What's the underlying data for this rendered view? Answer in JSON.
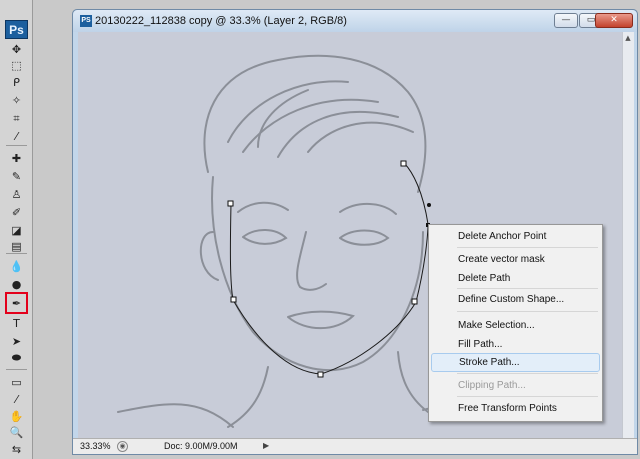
{
  "app": {
    "logo": "Ps"
  },
  "tools": [
    {
      "icon": "move-tool-icon",
      "glyph": "✥"
    },
    {
      "icon": "marquee-tool-icon",
      "glyph": "⬚"
    },
    {
      "icon": "lasso-tool-icon",
      "glyph": "ᑭ"
    },
    {
      "icon": "magic-wand-icon",
      "glyph": "✧"
    },
    {
      "icon": "crop-tool-icon",
      "glyph": "⌗"
    },
    {
      "icon": "eyedropper-tool-icon",
      "glyph": "⁄"
    },
    {
      "icon": "healing-brush-icon",
      "glyph": "✚"
    },
    {
      "icon": "brush-tool-icon",
      "glyph": "✎"
    },
    {
      "icon": "clone-stamp-icon",
      "glyph": "♙"
    },
    {
      "icon": "history-brush-icon",
      "glyph": "✐"
    },
    {
      "icon": "eraser-tool-icon",
      "glyph": "◪"
    },
    {
      "icon": "gradient-tool-icon",
      "glyph": "▤"
    },
    {
      "icon": "blur-tool-icon",
      "glyph": "💧"
    },
    {
      "icon": "dodge-tool-icon",
      "glyph": "●"
    },
    {
      "icon": "pen-tool-icon",
      "glyph": "✒"
    },
    {
      "icon": "type-tool-icon",
      "glyph": "T"
    },
    {
      "icon": "path-selection-icon",
      "glyph": "➤"
    },
    {
      "icon": "shape-tool-icon",
      "glyph": "⬬"
    },
    {
      "icon": "notes-tool-icon",
      "glyph": "▭"
    },
    {
      "icon": "eyedropper-3d-icon",
      "glyph": "⁄"
    },
    {
      "icon": "hand-tool-icon",
      "glyph": "✋"
    },
    {
      "icon": "zoom-tool-icon",
      "glyph": "🔍"
    },
    {
      "icon": "swap-colors-icon",
      "glyph": "⇆"
    }
  ],
  "document": {
    "title": "20130222_112838 copy @ 33.3% (Layer 2, RGB/8)",
    "icon_label": "PS",
    "minimize": "—",
    "maximize": "▭",
    "close": "✕"
  },
  "status": {
    "zoom": "33.33%",
    "doc_info": "Doc: 9.00M/9.00M",
    "arrow": "▶"
  },
  "context_menu": [
    {
      "label": "Delete Anchor Point",
      "enabled": true
    },
    {
      "label": "Create vector mask",
      "enabled": true
    },
    {
      "label": "Delete Path",
      "enabled": true
    },
    {
      "label": "Define Custom Shape...",
      "enabled": true
    },
    {
      "label": "Make Selection...",
      "enabled": true
    },
    {
      "label": "Fill Path...",
      "enabled": true
    },
    {
      "label": "Stroke Path...",
      "enabled": true,
      "hovered": true
    },
    {
      "label": "Clipping Path...",
      "enabled": false
    },
    {
      "label": "Free Transform Points",
      "enabled": true
    }
  ],
  "colors": {
    "highlight": "#e3001b",
    "menu_hover": "#e3eef9",
    "canvas": "#c8ccd8"
  }
}
